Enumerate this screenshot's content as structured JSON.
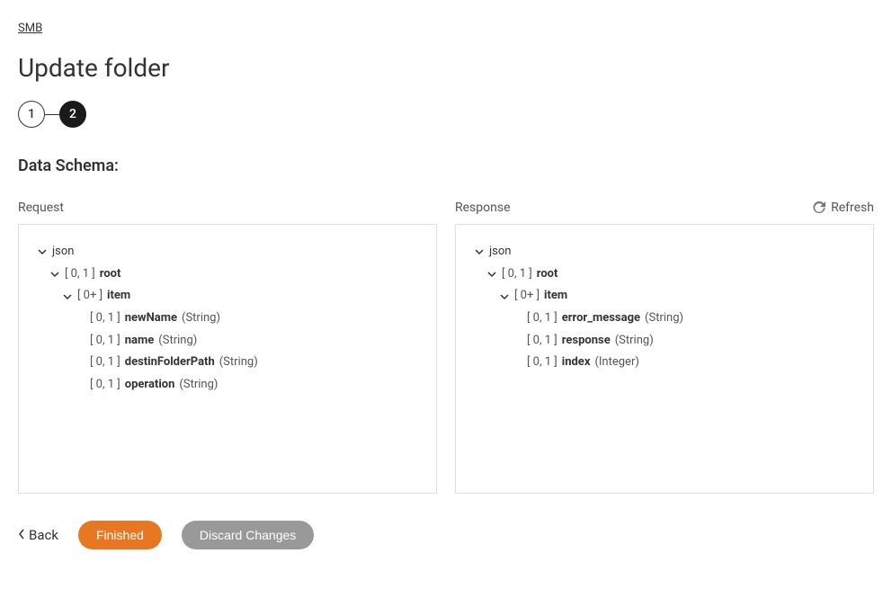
{
  "breadcrumb": "SMB",
  "page_title": "Update folder",
  "stepper": {
    "step1": "1",
    "step2": "2"
  },
  "section_title": "Data Schema:",
  "refresh_label": "Refresh",
  "request": {
    "label": "Request",
    "tree": {
      "json": "json",
      "root_card": "[ 0, 1 ]",
      "root_name": "root",
      "item_card": "[ 0+ ]",
      "item_name": "item",
      "fields": [
        {
          "card": "[ 0, 1 ]",
          "name": "newName",
          "type": "(String)"
        },
        {
          "card": "[ 0, 1 ]",
          "name": "name",
          "type": "(String)"
        },
        {
          "card": "[ 0, 1 ]",
          "name": "destinFolderPath",
          "type": "(String)"
        },
        {
          "card": "[ 0, 1 ]",
          "name": "operation",
          "type": "(String)"
        }
      ]
    }
  },
  "response": {
    "label": "Response",
    "tree": {
      "json": "json",
      "root_card": "[ 0, 1 ]",
      "root_name": "root",
      "item_card": "[ 0+ ]",
      "item_name": "item",
      "fields": [
        {
          "card": "[ 0, 1 ]",
          "name": "error_message",
          "type": "(String)"
        },
        {
          "card": "[ 0, 1 ]",
          "name": "response",
          "type": "(String)"
        },
        {
          "card": "[ 0, 1 ]",
          "name": "index",
          "type": "(Integer)"
        }
      ]
    }
  },
  "actions": {
    "back": "Back",
    "finished": "Finished",
    "discard": "Discard Changes"
  }
}
